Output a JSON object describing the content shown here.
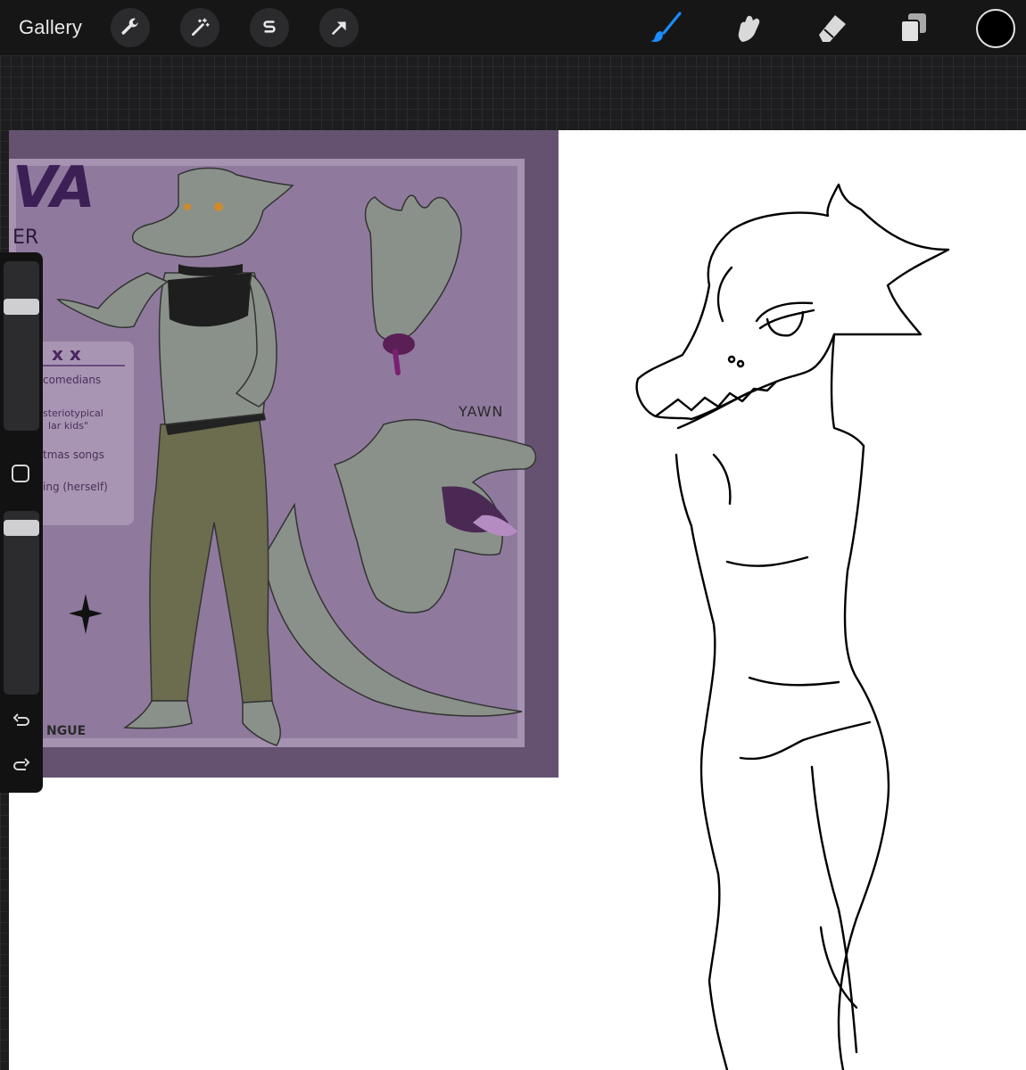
{
  "toolbar": {
    "gallery_label": "Gallery",
    "left_tools": [
      {
        "icon": "wrench-icon",
        "name": "actions"
      },
      {
        "icon": "magic-wand-icon",
        "name": "adjustments"
      },
      {
        "icon": "selection-s-icon",
        "name": "selection"
      },
      {
        "icon": "arrow-cursor-icon",
        "name": "transform"
      }
    ],
    "right_tools": [
      {
        "icon": "brush-icon",
        "name": "paint",
        "active": true,
        "color": "#1a8cff"
      },
      {
        "icon": "smudge-icon",
        "name": "smudge"
      },
      {
        "icon": "eraser-icon",
        "name": "erase"
      },
      {
        "icon": "layers-icon",
        "name": "layers"
      }
    ],
    "current_color": "#000000"
  },
  "reference": {
    "title_fragment": "VA",
    "subtitle_fragment": "ER",
    "likes_header": "x x",
    "list": [
      "comedians",
      "steriotypical",
      "lar kids\"",
      "tmas songs",
      "ing (herself)"
    ],
    "yawn_label": "YAWN",
    "bottom_label": "NGUE",
    "colors": {
      "frame": "#655271",
      "panel": "#8f7a9e",
      "skin": "#8a918a",
      "pants": "#6c6c4e"
    }
  },
  "sidebar": {
    "brush_size_level": 0.1,
    "opacity_level": 0.05,
    "modify_icon": "square-modify-icon",
    "undo_icon": "undo-icon",
    "redo_icon": "redo-icon"
  }
}
